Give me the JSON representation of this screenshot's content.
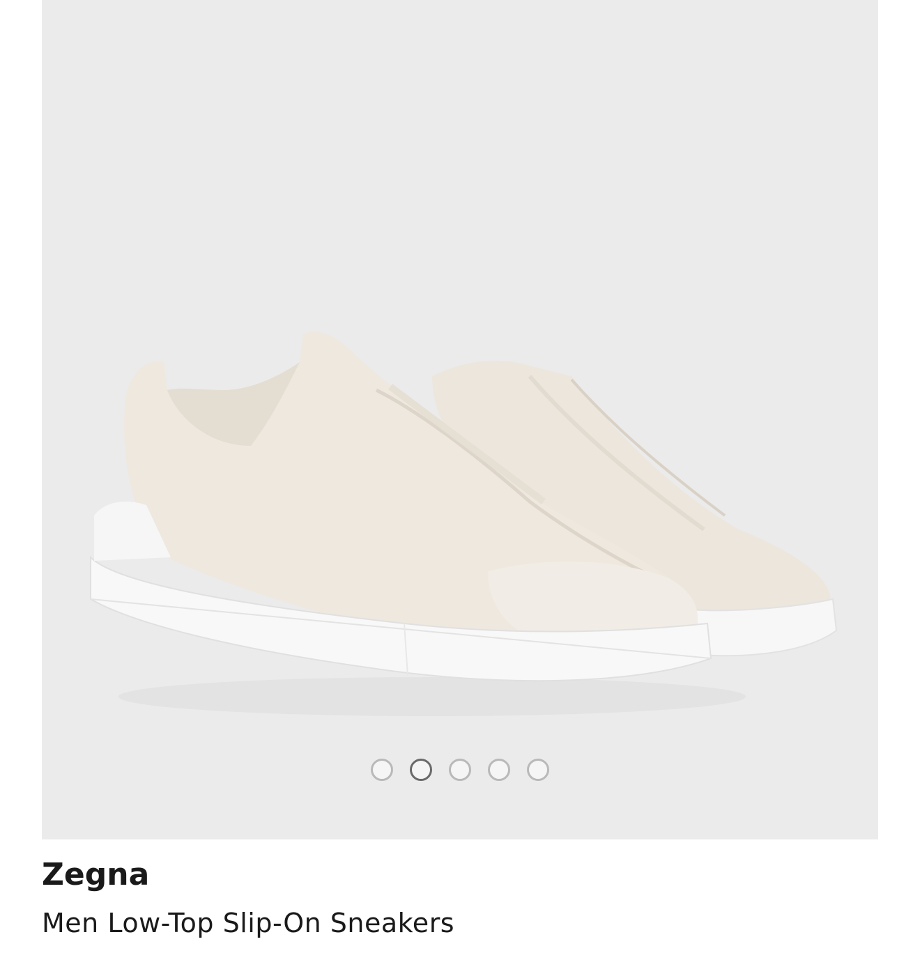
{
  "product": {
    "brand": "Zegna",
    "title": "Men Low-Top Slip-On Sneakers",
    "image_alt_icon": "sneaker-pair-image"
  },
  "carousel": {
    "total_slides": 5,
    "active_index": 1
  },
  "colors": {
    "image_background": "#ebebeb",
    "shoe_leather": "#ede7de",
    "sole": "#f8f8f8",
    "dot_border": "#b9b9b9",
    "dot_active_border": "#6a6a6a",
    "text": "#1a1a1a"
  }
}
